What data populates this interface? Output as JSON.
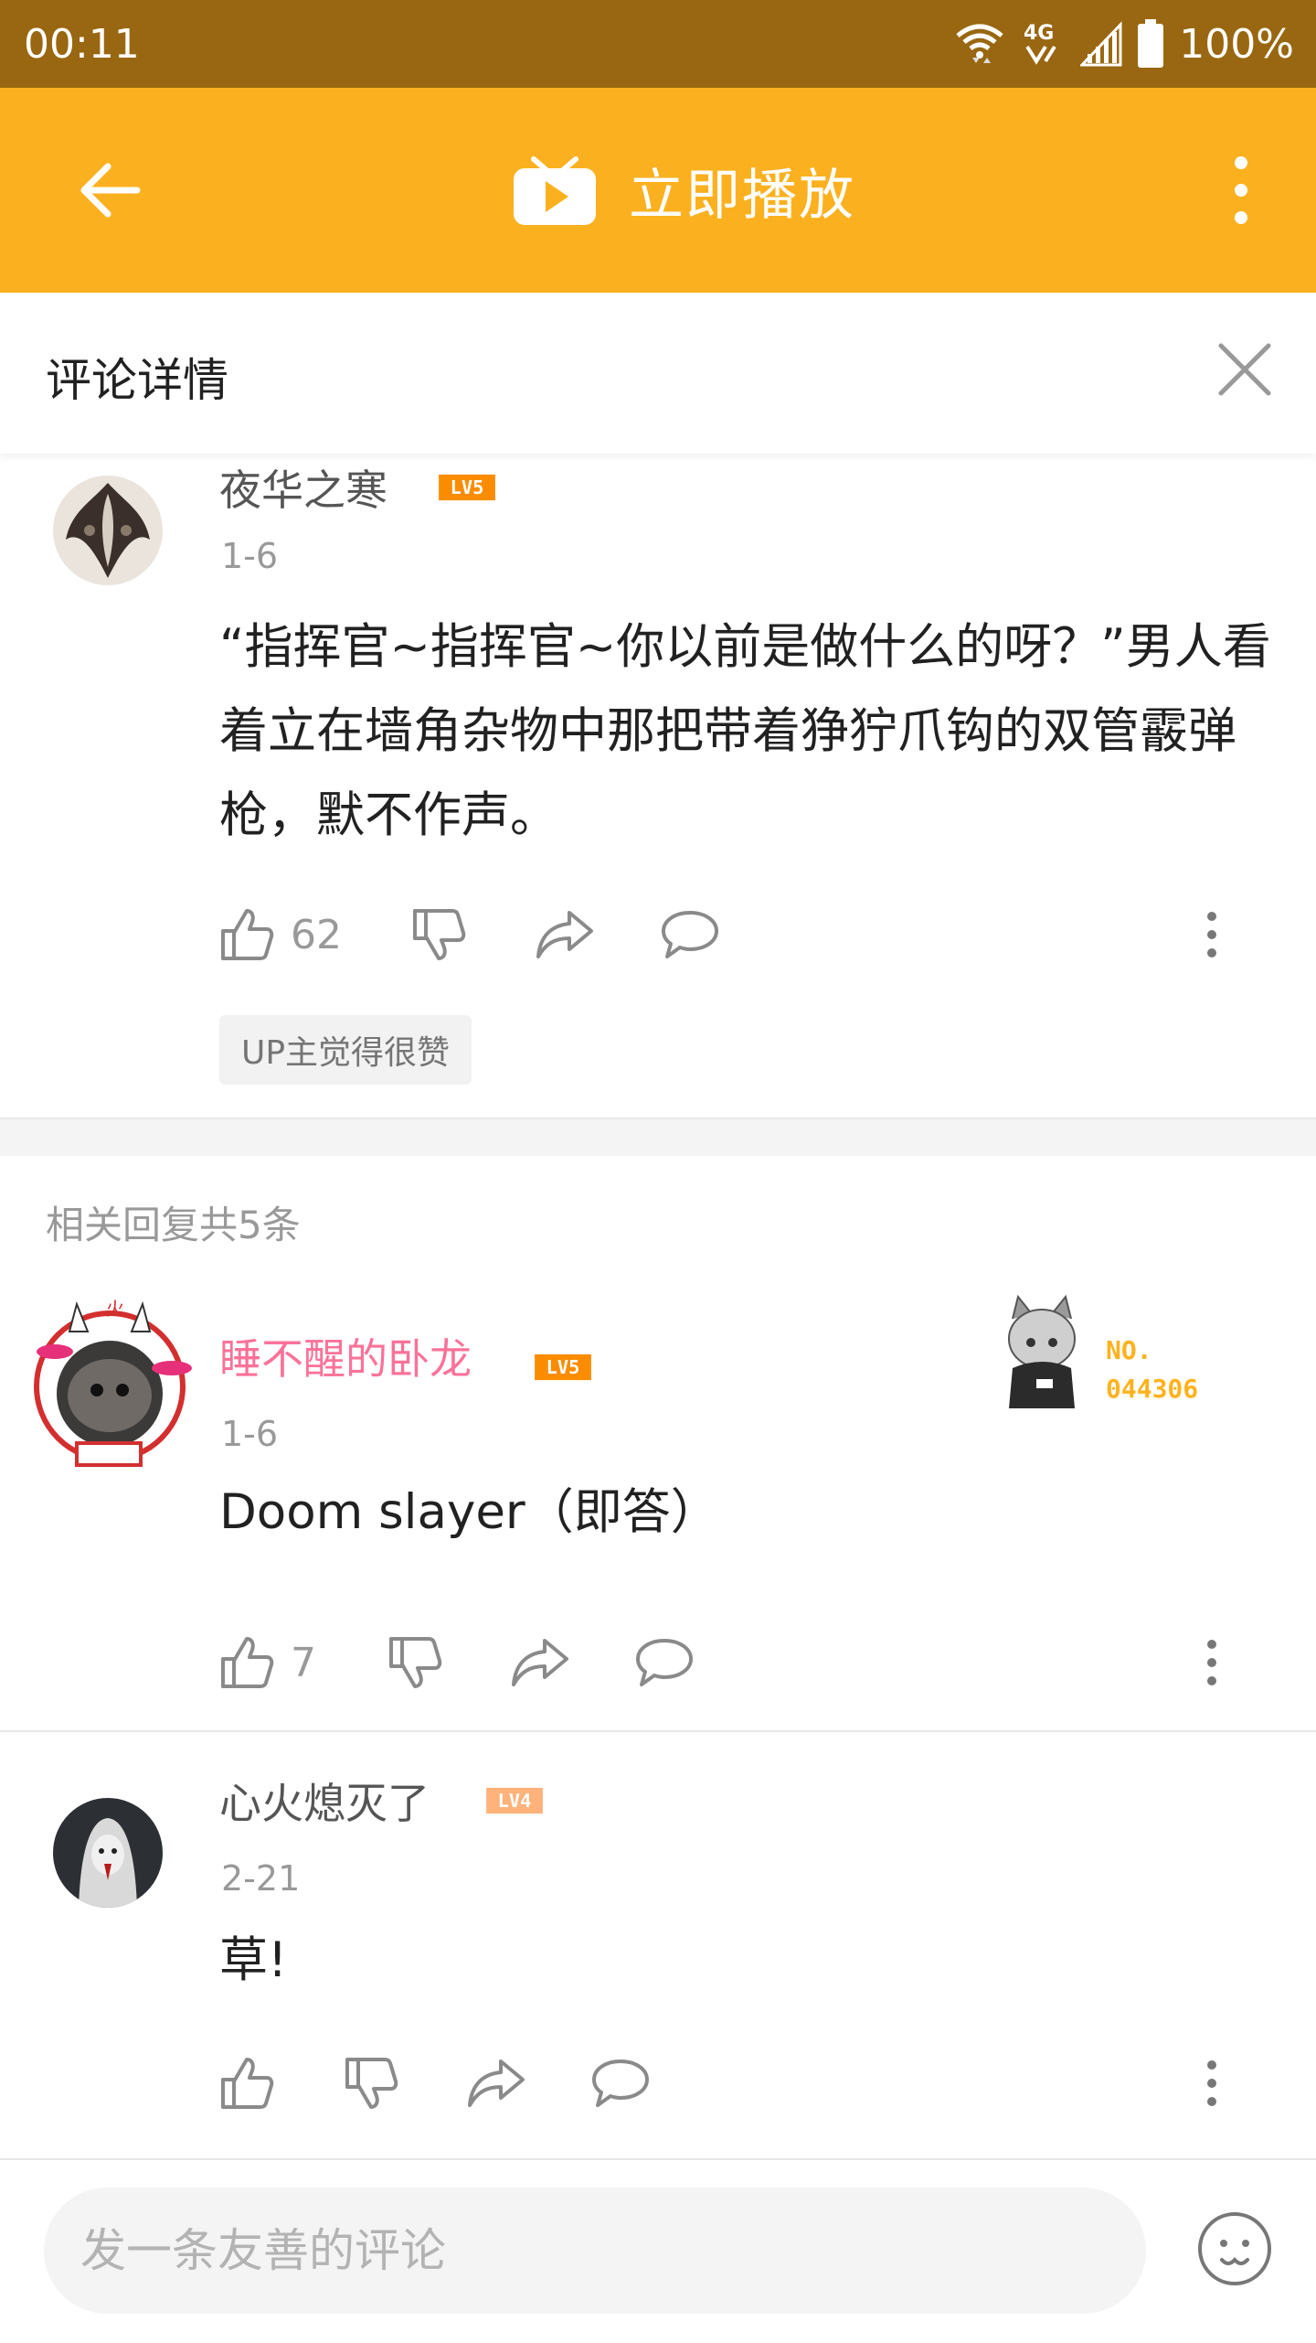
{
  "status_bar": {
    "time": "00:11",
    "network": "4G",
    "battery": "100%",
    "icons": [
      "wifi-icon",
      "network-4g-icon",
      "signal-icon",
      "battery-icon"
    ]
  },
  "app_bar": {
    "title": "立即播放",
    "icons": [
      "back-arrow-icon",
      "tv-play-icon",
      "more-vert-icon"
    ]
  },
  "detail": {
    "title": "评论详情",
    "close_icon": "close-icon"
  },
  "main_comment": {
    "username": "夜华之寒",
    "level": "LV5",
    "date": "1-6",
    "text": "“指挥官~指挥官~你以前是做什么的呀？”男人看着立在墙角杂物中那把带着狰狞爪钩的双管霰弹枪，默不作声。",
    "likes": "62",
    "up_badge": "UP主觉得很赞"
  },
  "replies_header": "相关回复共5条",
  "replies": [
    {
      "username": "睡不醒的卧龙",
      "level": "LV5",
      "date": "1-6",
      "text": "Doom slayer（即答）",
      "likes": "7",
      "nameplate": {
        "label": "NO.",
        "number": "044306"
      }
    },
    {
      "username": "心火熄灭了",
      "level": "LV4",
      "date": "2-21",
      "text": "草!",
      "likes": ""
    }
  ],
  "bottom_bar": {
    "placeholder": "发一条友善的评论",
    "emoji_icon": "emoji-face-icon"
  },
  "colors": {
    "status_bar": "#996711",
    "app_bar": "#fbb11f",
    "pink_username": "#fb7299",
    "level_orange": "#fb8c00",
    "level_light": "#ffb27a"
  }
}
